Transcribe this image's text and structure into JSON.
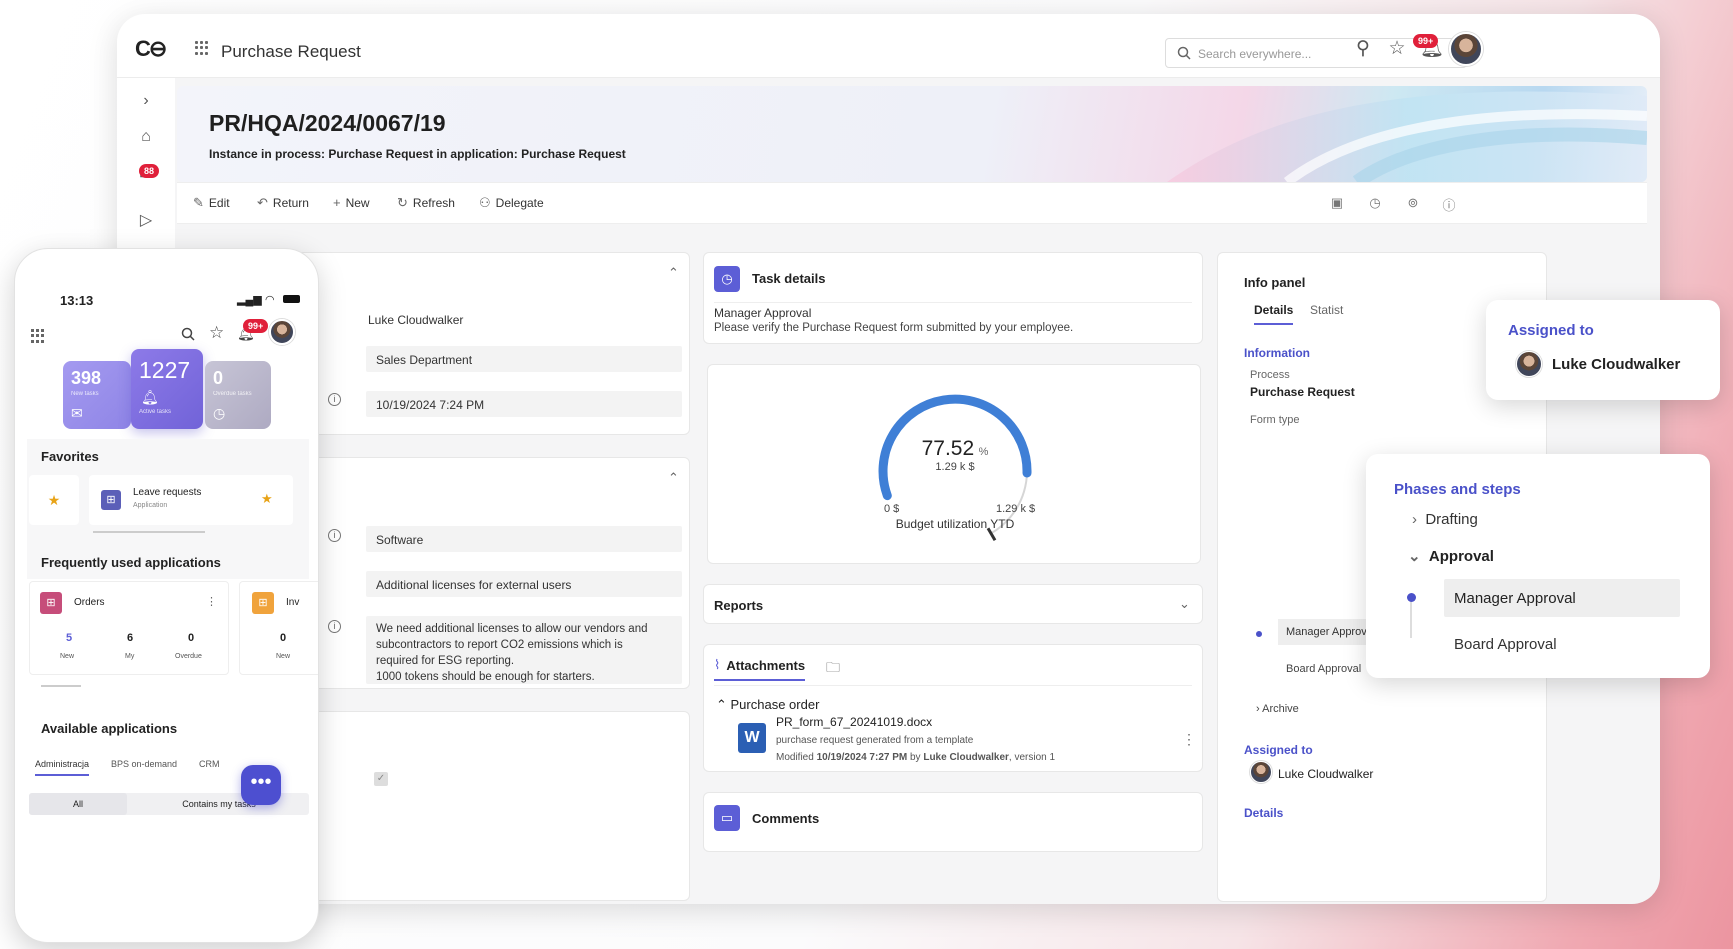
{
  "app": {
    "title": "Purchase Request",
    "search_placeholder": "Search everywhere...",
    "notifications_badge": "99+",
    "rail_badge": "88"
  },
  "header": {
    "id": "PR/HQA/2024/0067/19",
    "subtitle": "Instance in process: Purchase Request in application: Purchase Request"
  },
  "toolbar": {
    "edit": "Edit",
    "return": "Return",
    "new": "New",
    "refresh": "Refresh",
    "delegate": "Delegate"
  },
  "form": {
    "requester": "Luke Cloudwalker",
    "department": "Sales Department",
    "date": "10/19/2024 7:24 PM",
    "category": "Software",
    "item": "Additional licenses for external users",
    "justification": [
      "We need additional licenses to allow our vendors and",
      "subcontractors to report CO2 emissions which is",
      "required for ESG reporting.",
      "1000 tokens should be enough for starters."
    ]
  },
  "task": {
    "title": "Task details",
    "step": "Manager Approval",
    "description": "Please verify the Purchase Request form submitted by your employee."
  },
  "gauge": {
    "value": "77.52",
    "unit": "%",
    "sub": "1.29 k $",
    "min_label": "0 $",
    "max_label": "1.29 k $",
    "caption": "Budget utilization YTD",
    "fill_percent": 77.52
  },
  "reports": {
    "title": "Reports"
  },
  "attachments": {
    "tab": "Attachments",
    "group": "Purchase order",
    "file_name": "PR_form_67_20241019.docx",
    "file_desc": "purchase request generated from a template",
    "modified_prefix": "Modified",
    "modified_date": "10/19/2024 7:27 PM",
    "by": "by",
    "author": "Luke Cloudwalker",
    "version": ", version 1"
  },
  "comments": {
    "title": "Comments"
  },
  "info_panel": {
    "title": "Info panel",
    "tab_details": "Details",
    "tab_stats": "Statist",
    "information": "Information",
    "process_label": "Process",
    "process_value": "Purchase Request",
    "form_type_label": "Form type",
    "step_manager": "Manager Approval",
    "step_board": "Board Approval",
    "archive": "Archive",
    "assigned_to": "Assigned to",
    "assignee": "Luke Cloudwalker",
    "details_link": "Details"
  },
  "assigned_popover": {
    "title": "Assigned to",
    "name": "Luke Cloudwalker"
  },
  "phases_popover": {
    "title": "Phases and steps",
    "drafting": "Drafting",
    "approval": "Approval",
    "manager": "Manager Approval",
    "board": "Board Approval"
  },
  "phone": {
    "time": "13:13",
    "badge": "99+",
    "tiles": [
      {
        "value": "398",
        "label": "New tasks"
      },
      {
        "value": "1227",
        "label": "Active tasks"
      },
      {
        "value": "0",
        "label": "Overdue tasks"
      }
    ],
    "favorites_title": "Favorites",
    "fav_name": "Leave requests",
    "fav_sub": "Application",
    "frequent_title": "Frequently used applications",
    "app1": {
      "name": "Orders",
      "stats": [
        {
          "v": "5",
          "l": "New"
        },
        {
          "v": "6",
          "l": "My"
        },
        {
          "v": "0",
          "l": "Overdue"
        }
      ]
    },
    "app2": {
      "name": "Inv",
      "stat_v": "0",
      "stat_l": "New"
    },
    "available_title": "Available applications",
    "tabs": [
      "Administracja",
      "BPS on-demand",
      "CRM"
    ],
    "filter_all": "All",
    "filter_mine": "Contains my tasks"
  }
}
